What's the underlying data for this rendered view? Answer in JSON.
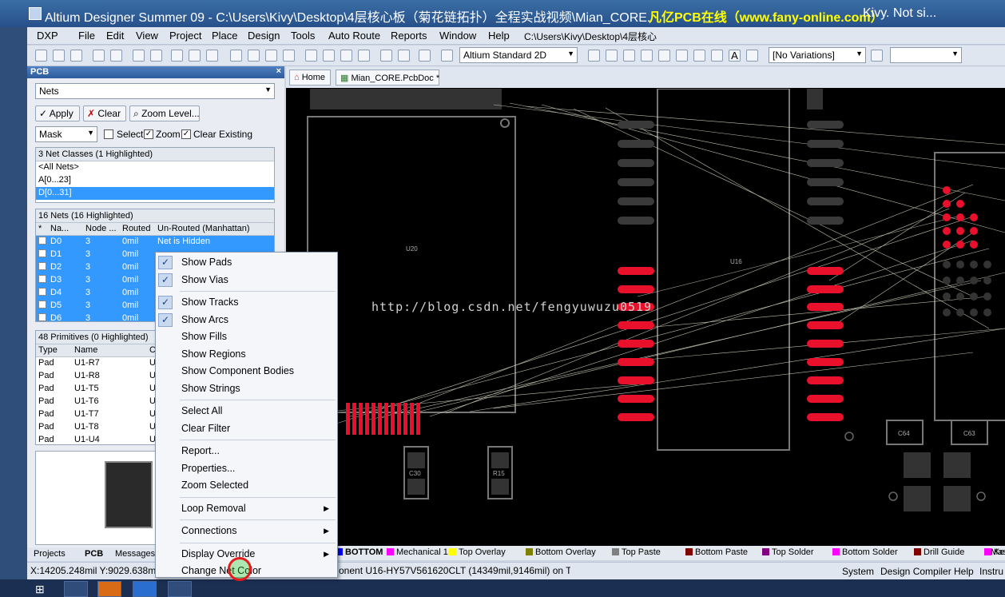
{
  "title": {
    "text": "Altium Designer Summer 09 - C:\\Users\\Kivy\\Desktop\\4层核心板（菊花链拓扑）全程实战视频\\Mian_CORE.PcbDoc - ",
    "watermark": "凡亿PCB在线（www.fany-online.com）",
    "rest": "Kivy. Not si..."
  },
  "menu": [
    "DXP",
    "File",
    "Edit",
    "View",
    "Project",
    "Place",
    "Design",
    "Tools",
    "Auto Route",
    "Reports",
    "Window",
    "Help"
  ],
  "path_combo": "C:\\Users\\Kivy\\Desktop\\4层核心",
  "toolbar": {
    "view_combo": "Altium Standard 2D",
    "variations": "[No Variations]"
  },
  "panel": {
    "title": "PCB",
    "mode": "Nets",
    "apply": "Apply",
    "clear": "Clear",
    "zoom_level": "Zoom Level...",
    "mask": "Mask",
    "select": "Select",
    "zoom": "Zoom",
    "clear_existing": "Clear Existing",
    "classes_header": "3 Net Classes (1 Highlighted)",
    "classes": [
      "<All Nets>",
      "A[0...23]",
      "D[0...31]"
    ],
    "nets_header": "16 Nets (16 Highlighted)",
    "net_cols": [
      "*",
      "Na...",
      "Node ...",
      "Routed",
      "Un-Routed (Manhattan)"
    ],
    "nets": [
      {
        "name": "D0",
        "node": "3",
        "routed": "0mil",
        "unrouted": "Net is Hidden"
      },
      {
        "name": "D1",
        "node": "3",
        "routed": "0mil",
        "unrouted": ""
      },
      {
        "name": "D2",
        "node": "3",
        "routed": "0mil",
        "unrouted": ""
      },
      {
        "name": "D3",
        "node": "3",
        "routed": "0mil",
        "unrouted": ""
      },
      {
        "name": "D4",
        "node": "3",
        "routed": "0mil",
        "unrouted": ""
      },
      {
        "name": "D5",
        "node": "3",
        "routed": "0mil",
        "unrouted": ""
      },
      {
        "name": "D6",
        "node": "3",
        "routed": "0mil",
        "unrouted": ""
      }
    ],
    "prims_header": "48 Primitives (0 Highlighted)",
    "prim_cols": [
      "Type",
      "Name",
      "C"
    ],
    "prims": [
      {
        "type": "Pad",
        "name": "U1-R7",
        "c": "U"
      },
      {
        "type": "Pad",
        "name": "U1-R8",
        "c": "U"
      },
      {
        "type": "Pad",
        "name": "U1-T5",
        "c": "U"
      },
      {
        "type": "Pad",
        "name": "U1-T6",
        "c": "U"
      },
      {
        "type": "Pad",
        "name": "U1-T7",
        "c": "U"
      },
      {
        "type": "Pad",
        "name": "U1-T8",
        "c": "U"
      },
      {
        "type": "Pad",
        "name": "U1-U4",
        "c": "U"
      }
    ]
  },
  "doc_tabs": {
    "home": "Home",
    "doc": "Mian_CORE.PcbDoc *"
  },
  "canvas": {
    "url_watermark": "http://blog.csdn.net/fengyuwuzu0519",
    "labels": {
      "u20": "U20",
      "u16": "U16",
      "c30": "C30",
      "r15": "R15",
      "c64": "C64",
      "c63": "C63"
    }
  },
  "context_menu": [
    {
      "label": "Show Pads",
      "checked": true
    },
    {
      "label": "Show Vias",
      "checked": true
    },
    {
      "sep": true
    },
    {
      "label": "Show Tracks",
      "checked": true
    },
    {
      "label": "Show Arcs",
      "checked": true
    },
    {
      "label": "Show Fills"
    },
    {
      "label": "Show Regions"
    },
    {
      "label": "Show Component Bodies"
    },
    {
      "label": "Show Strings"
    },
    {
      "sep": true
    },
    {
      "label": "Select All"
    },
    {
      "label": "Clear Filter"
    },
    {
      "sep": true
    },
    {
      "label": "Report..."
    },
    {
      "label": "Properties..."
    },
    {
      "label": "Zoom Selected"
    },
    {
      "sep": true
    },
    {
      "label": "Loop Removal",
      "submenu": true
    },
    {
      "sep": true
    },
    {
      "label": "Connections",
      "submenu": true
    },
    {
      "sep": true
    },
    {
      "label": "Display Override",
      "submenu": true
    },
    {
      "label": "Change Net Color"
    }
  ],
  "panel_tabs": [
    "Projects",
    "PCB",
    "Messages"
  ],
  "layers": [
    {
      "name": "BOTTOM",
      "color": "#0000ff"
    },
    {
      "name": "Mechanical 1",
      "color": "#ff00ff"
    },
    {
      "name": "Top Overlay",
      "color": "#ffff00"
    },
    {
      "name": "Bottom Overlay",
      "color": "#808000"
    },
    {
      "name": "Top Paste",
      "color": "#808080"
    },
    {
      "name": "Bottom Paste",
      "color": "#800000"
    },
    {
      "name": "Top Solder",
      "color": "#800080"
    },
    {
      "name": "Bottom Solder",
      "color": "#ff00ff"
    },
    {
      "name": "Drill Guide",
      "color": "#800000"
    },
    {
      "name": "Kee",
      "color": "#ff00ff"
    }
  ],
  "layer_more": "Mas",
  "status": {
    "coords": "X:14205.248mil Y:9029.638mil",
    "component": "onent U16-HY57V561620CLT (14349mil,9146mil) on TOP",
    "system": "System",
    "design_compiler": "Design Compiler",
    "help": "Help",
    "instru": "Instru"
  }
}
